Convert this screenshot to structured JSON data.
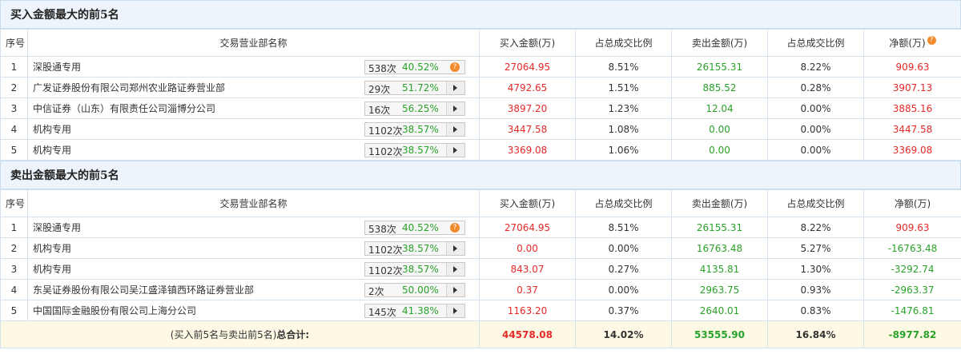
{
  "buy_section": {
    "title": "买入金额最大的前5名",
    "headers": [
      "序号",
      "交易营业部名称",
      "买入金额(万)",
      "占总成交比例",
      "卖出金额(万)",
      "占总成交比例",
      "净额(万)"
    ],
    "rows": [
      {
        "idx": "1",
        "name": "深股通专用",
        "count": "538次",
        "pct": "40.52%",
        "icon": "question-icon",
        "buy": "27064.95",
        "buy_ratio": "8.51%",
        "sell": "26155.31",
        "sell_ratio": "8.22%",
        "net": "909.63"
      },
      {
        "idx": "2",
        "name": "广发证券股份有限公司郑州农业路证券营业部",
        "count": "29次",
        "pct": "51.72%",
        "icon": "arrow",
        "buy": "4792.65",
        "buy_ratio": "1.51%",
        "sell": "885.52",
        "sell_ratio": "0.28%",
        "net": "3907.13"
      },
      {
        "idx": "3",
        "name": "中信证券（山东）有限责任公司淄博分公司",
        "count": "16次",
        "pct": "56.25%",
        "icon": "arrow",
        "buy": "3897.20",
        "buy_ratio": "1.23%",
        "sell": "12.04",
        "sell_ratio": "0.00%",
        "net": "3885.16"
      },
      {
        "idx": "4",
        "name": "机构专用",
        "count": "1102次",
        "pct": "38.57%",
        "icon": "arrow",
        "buy": "3447.58",
        "buy_ratio": "1.08%",
        "sell": "0.00",
        "sell_ratio": "0.00%",
        "net": "3447.58"
      },
      {
        "idx": "5",
        "name": "机构专用",
        "count": "1102次",
        "pct": "38.57%",
        "icon": "arrow",
        "buy": "3369.08",
        "buy_ratio": "1.06%",
        "sell": "0.00",
        "sell_ratio": "0.00%",
        "net": "3369.08"
      }
    ]
  },
  "sell_section": {
    "title": "卖出金额最大的前5名",
    "headers": [
      "序号",
      "交易营业部名称",
      "买入金额(万)",
      "占总成交比例",
      "卖出金额(万)",
      "占总成交比例",
      "净额(万)"
    ],
    "rows": [
      {
        "idx": "1",
        "name": "深股通专用",
        "count": "538次",
        "pct": "40.52%",
        "icon": "question-icon",
        "buy": "27064.95",
        "buy_ratio": "8.51%",
        "sell": "26155.31",
        "sell_ratio": "8.22%",
        "net": "909.63"
      },
      {
        "idx": "2",
        "name": "机构专用",
        "count": "1102次",
        "pct": "38.57%",
        "icon": "arrow",
        "buy": "0.00",
        "buy_ratio": "0.00%",
        "sell": "16763.48",
        "sell_ratio": "5.27%",
        "net": "-16763.48"
      },
      {
        "idx": "3",
        "name": "机构专用",
        "count": "1102次",
        "pct": "38.57%",
        "icon": "arrow",
        "buy": "843.07",
        "buy_ratio": "0.27%",
        "sell": "4135.81",
        "sell_ratio": "1.30%",
        "net": "-3292.74"
      },
      {
        "idx": "4",
        "name": "东吴证券股份有限公司吴江盛泽镇西环路证券营业部",
        "count": "2次",
        "pct": "50.00%",
        "icon": "arrow",
        "buy": "0.37",
        "buy_ratio": "0.00%",
        "sell": "2963.75",
        "sell_ratio": "0.93%",
        "net": "-2963.37"
      },
      {
        "idx": "5",
        "name": "中国国际金融股份有限公司上海分公司",
        "count": "145次",
        "pct": "41.38%",
        "icon": "arrow",
        "buy": "1163.20",
        "buy_ratio": "0.37%",
        "sell": "2640.01",
        "sell_ratio": "0.83%",
        "net": "-1476.81"
      }
    ]
  },
  "total": {
    "label_prefix": "(买入前5名与卖出前5名)",
    "label_suffix": "总合计:",
    "buy": "44578.08",
    "buy_ratio": "14.02%",
    "sell": "53555.90",
    "sell_ratio": "16.84%",
    "net": "-8977.82"
  },
  "colors": {
    "positive": "#e52a2a",
    "negative": "#2aa22a",
    "header_bg": "#edf4fb",
    "total_bg": "#fdf9e5"
  }
}
